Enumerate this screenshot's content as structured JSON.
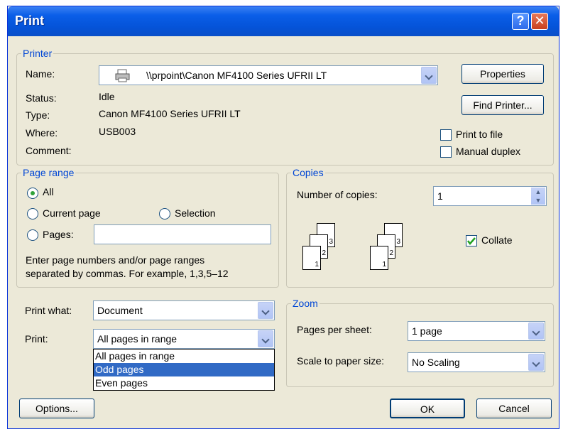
{
  "window": {
    "title": "Print"
  },
  "printer": {
    "legend": "Printer",
    "name_label": "Name:",
    "name_value": "\\\\prpoint\\Canon MF4100 Series UFRII LT",
    "status_label": "Status:",
    "status_value": "Idle",
    "type_label": "Type:",
    "type_value": "Canon MF4100 Series UFRII LT",
    "where_label": "Where:",
    "where_value": "USB003",
    "comment_label": "Comment:",
    "properties_label": "Properties",
    "find_printer_label": "Find Printer...",
    "print_to_file_label": "Print to file",
    "manual_duplex_label": "Manual duplex"
  },
  "page_range": {
    "legend": "Page range",
    "all_label": "All",
    "current_page_label": "Current page",
    "selection_label": "Selection",
    "pages_label": "Pages:",
    "pages_value": "",
    "hint_line1": "Enter page numbers and/or page ranges",
    "hint_line2": "separated by commas.  For example, 1,3,5–12"
  },
  "copies": {
    "legend": "Copies",
    "number_label": "Number of copies:",
    "number_value": "1",
    "collate_label": "Collate",
    "page_numbers": [
      "1",
      "2",
      "3"
    ]
  },
  "print_what": {
    "label": "Print what:",
    "value": "Document"
  },
  "print": {
    "label": "Print:",
    "value": "All pages in range",
    "options": [
      "All pages in range",
      "Odd pages",
      "Even pages"
    ],
    "highlighted_index": 1
  },
  "zoom": {
    "legend": "Zoom",
    "pages_per_sheet_label": "Pages per sheet:",
    "pages_per_sheet_value": "1 page",
    "scale_label": "Scale to paper size:",
    "scale_value": "No Scaling"
  },
  "buttons": {
    "options": "Options...",
    "ok": "OK",
    "cancel": "Cancel"
  },
  "colors": {
    "title_bar": "#0553d8",
    "legend": "#0046d5",
    "highlight": "#316ac5",
    "face": "#ece9d8"
  }
}
